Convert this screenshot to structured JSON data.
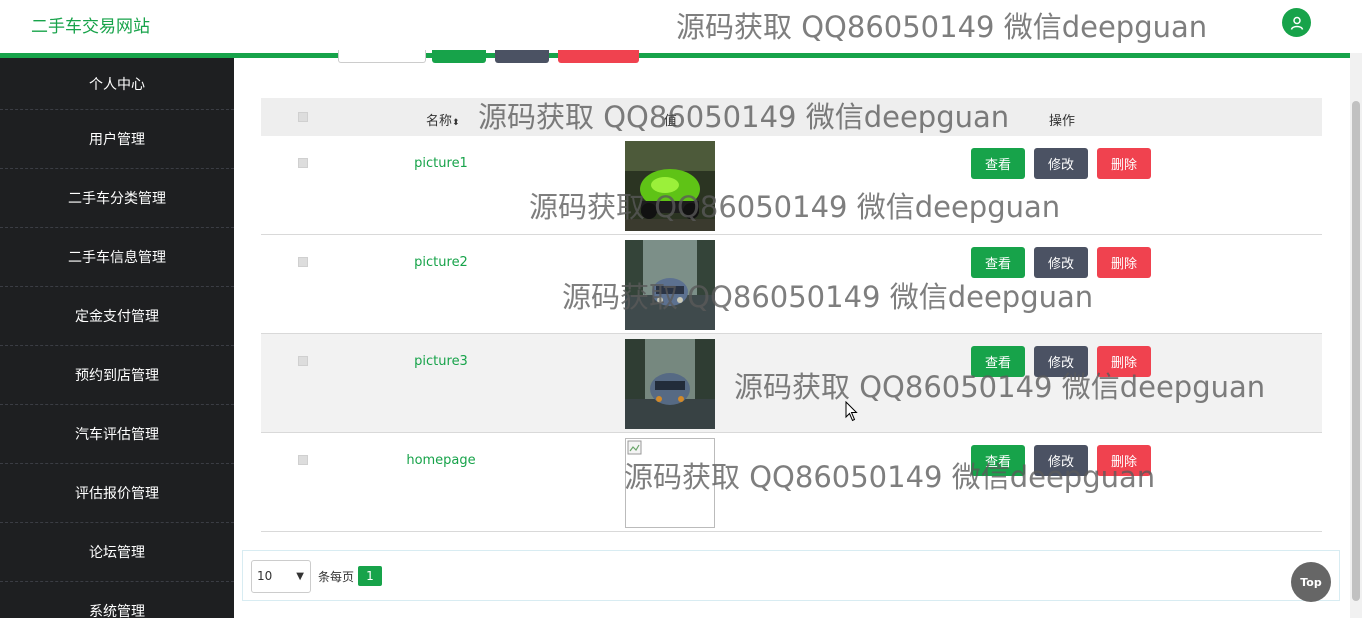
{
  "header": {
    "site_title": "二手车交易网站",
    "avatar_icon": "user-icon"
  },
  "sidebar": {
    "items": [
      {
        "label": "个人中心"
      },
      {
        "label": "用户管理"
      },
      {
        "label": "二手车分类管理"
      },
      {
        "label": "二手车信息管理"
      },
      {
        "label": "定金支付管理"
      },
      {
        "label": "预约到店管理"
      },
      {
        "label": "汽车评估管理"
      },
      {
        "label": "评估报价管理"
      },
      {
        "label": "论坛管理"
      },
      {
        "label": "系统管理"
      }
    ]
  },
  "table": {
    "headers": {
      "name": "名称",
      "value": "值",
      "actions": "操作"
    },
    "rows": [
      {
        "name": "picture1",
        "image": "green sports car"
      },
      {
        "name": "picture2",
        "image": "car on wet road"
      },
      {
        "name": "picture3",
        "image": "car on wet road"
      },
      {
        "name": "homepage",
        "image": "broken image"
      }
    ],
    "actions": {
      "view": "查看",
      "edit": "修改",
      "delete": "删除"
    }
  },
  "pagination": {
    "page_size": "10",
    "per_page_label": "条每页",
    "current_page": "1"
  },
  "top_button": "Top",
  "watermark": "源码获取 QQ86050149 微信deepguan",
  "colors": {
    "accent": "#17a34a",
    "edit": "#4b5263",
    "delete": "#f0424f",
    "sidebar": "#1e1f21"
  }
}
